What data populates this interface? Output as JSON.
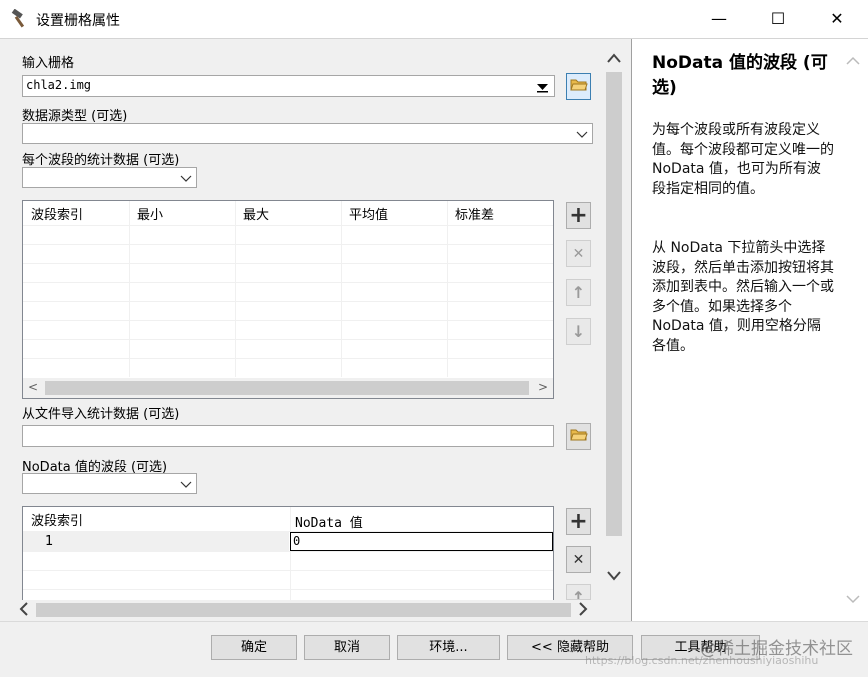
{
  "window": {
    "title": "设置栅格属性",
    "minimize_glyph": "—",
    "maximize_glyph": "☐",
    "close_glyph": "✕",
    "app_icon": "hammer-icon"
  },
  "form": {
    "input_raster_label": "输入栅格",
    "input_raster_value": "chla2.img",
    "datasource_label": "数据源类型 (可选)",
    "datasource_value": "",
    "band_stats_label": "每个波段的统计数据 (可选)",
    "band_stats_value": "",
    "stats_columns": [
      "波段索引",
      "最小",
      "最大",
      "平均值",
      "标准差"
    ],
    "import_stats_label": "从文件导入统计数据 (可选)",
    "import_stats_value": "",
    "nodata_band_label": "NoData 值的波段 (可选)",
    "nodata_band_value": "",
    "nodata_columns": [
      "波段索引",
      "NoData 值"
    ],
    "nodata_rows": [
      {
        "band": "1",
        "value": "0"
      }
    ]
  },
  "side_buttons": {
    "add": "+",
    "remove": "✕",
    "up": "↑",
    "down": "↓"
  },
  "help": {
    "title": "NoData 值的波段 (可选)",
    "paragraph1": "为每个波段或所有波段定义值。每个波段都可定义唯一的 NoData 值，也可为所有波段指定相同的值。",
    "paragraph2": "从 NoData 下拉箭头中选择波段，然后单击添加按钮将其添加到表中。然后输入一个或多个值。如果选择多个 NoData 值，则用空格分隔各值。"
  },
  "buttons": {
    "ok": "确定",
    "cancel": "取消",
    "environments": "环境...",
    "hide_help": "<< 隐藏帮助",
    "tool_help": "工具帮助"
  },
  "watermark": {
    "main": "@稀土掘金技术社区",
    "url": "https://blog.csdn.net/zhenhoushiyiaoshihu"
  },
  "colors": {
    "folder_icon": "#e8b94a",
    "add_button_symbol": "#333333",
    "disabled_symbol": "#9a9a9a"
  }
}
